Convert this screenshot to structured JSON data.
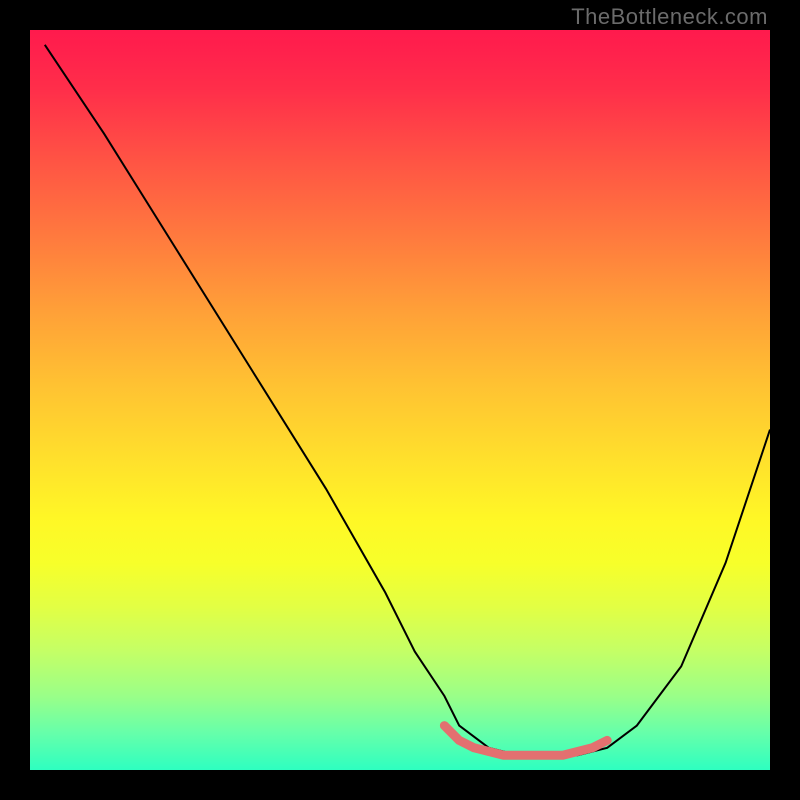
{
  "watermark": "TheBottleneck.com",
  "chart_data": {
    "type": "line",
    "title": "",
    "xlabel": "",
    "ylabel": "",
    "xlim": [
      0,
      100
    ],
    "ylim": [
      0,
      100
    ],
    "grid": false,
    "legend": false,
    "series": [
      {
        "name": "bottleneck-curve",
        "x": [
          2,
          10,
          20,
          30,
          40,
          48,
          52,
          56,
          58,
          62,
          66,
          70,
          74,
          78,
          82,
          88,
          94,
          100
        ],
        "values": [
          98,
          86,
          70,
          54,
          38,
          24,
          16,
          10,
          6,
          3,
          2,
          2,
          2,
          3,
          6,
          14,
          28,
          46
        ],
        "stroke": "#000000",
        "stroke_width": 2
      },
      {
        "name": "optimal-highlight",
        "x": [
          56,
          58,
          60,
          62,
          64,
          66,
          68,
          70,
          72,
          74,
          76,
          78
        ],
        "values": [
          6,
          4,
          3,
          2.5,
          2,
          2,
          2,
          2,
          2,
          2.5,
          3,
          4
        ],
        "stroke": "#e37070",
        "stroke_width": 9
      }
    ],
    "background_gradient": {
      "type": "vertical",
      "stops": [
        {
          "pos": 0.0,
          "color": "#ff1a4d"
        },
        {
          "pos": 0.5,
          "color": "#ffcc30"
        },
        {
          "pos": 0.8,
          "color": "#e2ff44"
        },
        {
          "pos": 1.0,
          "color": "#2effc0"
        }
      ]
    }
  }
}
